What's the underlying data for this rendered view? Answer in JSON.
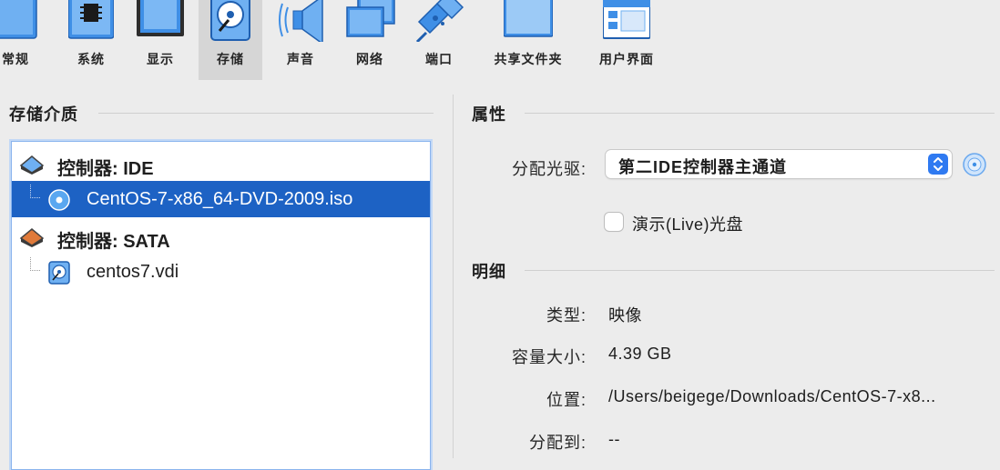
{
  "toolbar": {
    "items": [
      {
        "label": "常规",
        "icon": "general-icon"
      },
      {
        "label": "系统",
        "icon": "system-chip-icon"
      },
      {
        "label": "显示",
        "icon": "display-monitor-icon"
      },
      {
        "label": "存储",
        "icon": "storage-disk-icon"
      },
      {
        "label": "声音",
        "icon": "speaker-icon"
      },
      {
        "label": "网络",
        "icon": "network-icon"
      },
      {
        "label": "端口",
        "icon": "port-connector-icon"
      },
      {
        "label": "共享文件夹",
        "icon": "shared-folder-icon"
      },
      {
        "label": "用户界面",
        "icon": "user-interface-window-icon"
      }
    ],
    "selected": "存储"
  },
  "storage": {
    "heading": "存储介质",
    "tree": [
      {
        "label": "控制器: IDE",
        "type": "controller",
        "icon": "ide-controller-icon"
      },
      {
        "label": "CentOS-7-x86_64-DVD-2009.iso",
        "type": "optical",
        "icon": "optical-disc-icon",
        "selected": true
      },
      {
        "label": "控制器: SATA",
        "type": "controller",
        "icon": "sata-controller-icon"
      },
      {
        "label": "centos7.vdi",
        "type": "harddisk",
        "icon": "hard-disk-icon"
      }
    ]
  },
  "attributes": {
    "heading": "属性",
    "drive_label": "分配光驱:",
    "drive_value": "第二IDE控制器主通道",
    "live_cd_label": "演示(Live)光盘",
    "live_cd_checked": false
  },
  "details": {
    "heading": "明细",
    "type_label": "类型:",
    "type_value": "映像",
    "size_label": "容量大小:",
    "size_value": "4.39 GB",
    "location_label": "位置:",
    "location_value": "/Users/beigege/Downloads/CentOS-7-x8...",
    "attached_label": "分配到:",
    "attached_value": "--"
  },
  "colors": {
    "selection": "#1d62c4",
    "accent": "#2f7af1",
    "toolbar_blue": "#3f8fe6"
  }
}
